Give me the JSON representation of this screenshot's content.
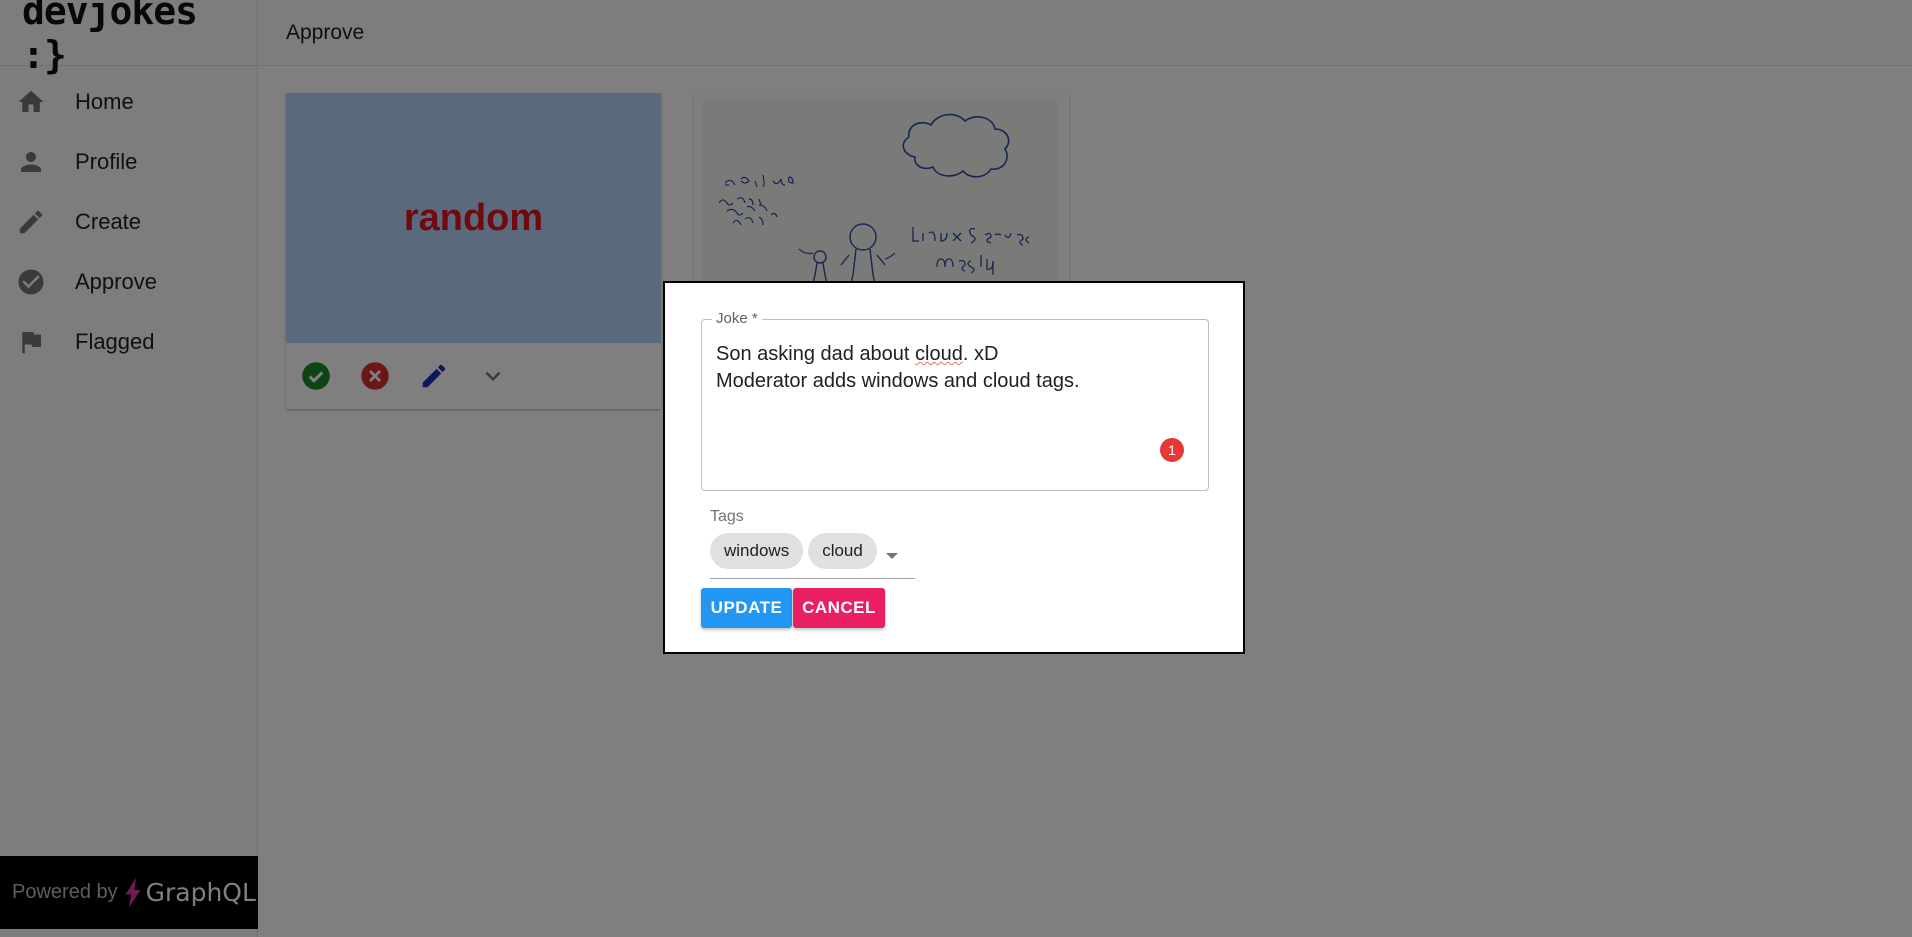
{
  "app": {
    "brand": "devjokes :}",
    "page_title": "Approve"
  },
  "sidebar": {
    "items": [
      {
        "label": "Home",
        "icon": "home-icon"
      },
      {
        "label": "Profile",
        "icon": "person-icon"
      },
      {
        "label": "Create",
        "icon": "pencil-icon"
      },
      {
        "label": "Approve",
        "icon": "check-circle-icon"
      },
      {
        "label": "Flagged",
        "icon": "flag-icon"
      }
    ],
    "powered_by": "Powered by",
    "powered_brand": "GraphQL"
  },
  "cards": [
    {
      "media_text": "random",
      "media_color": "#b4d2f7",
      "text_color": "#e0141e"
    },
    {
      "media_text": "",
      "image": "whiteboard-drawing"
    }
  ],
  "dialog": {
    "joke_label": "Joke *",
    "joke_line1_a": "Son asking dad about ",
    "joke_line1_b": "cloud",
    "joke_line1_c": ". xD",
    "joke_line2": "Moderator adds windows and cloud tags.",
    "badge_count": "1",
    "tags_label": "Tags",
    "tags": [
      "windows",
      "cloud"
    ],
    "update_label": "UPDATE",
    "cancel_label": "CANCEL"
  },
  "colors": {
    "update": "#2196f3",
    "cancel": "#e91e63",
    "approve": "#1b8a2a",
    "reject": "#d32f2f",
    "edit": "#1e2fb8"
  }
}
